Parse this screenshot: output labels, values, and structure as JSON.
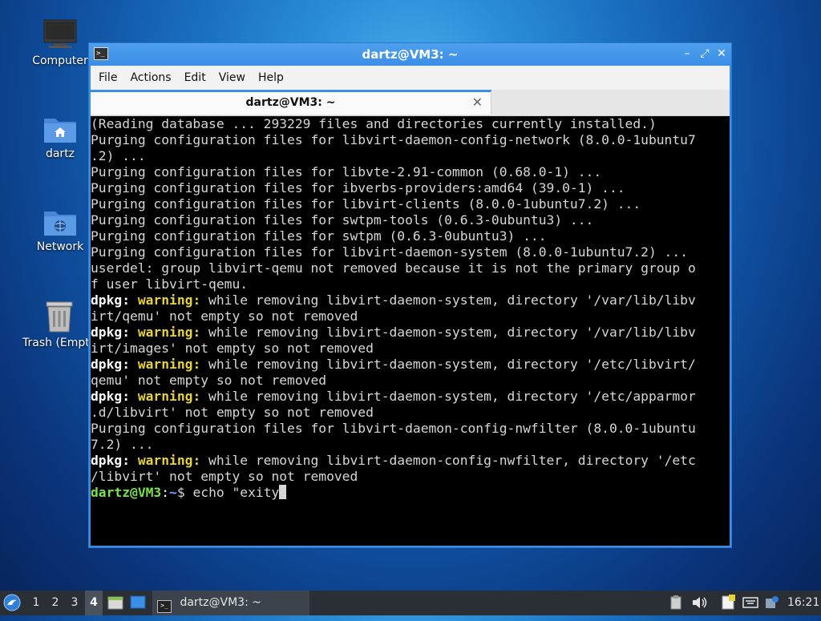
{
  "desktop": {
    "icons": [
      {
        "label": "Computer"
      },
      {
        "label": "dartz"
      },
      {
        "label": "Network"
      },
      {
        "label": "Trash (Empty)"
      }
    ]
  },
  "window": {
    "title": "dartz@VM3: ~",
    "controls": {
      "minimize": "–",
      "maximize": "⤢",
      "close": "✕"
    },
    "menu": [
      "File",
      "Actions",
      "Edit",
      "View",
      "Help"
    ],
    "tab": {
      "label": "dartz@VM3: ~",
      "close": "✕"
    }
  },
  "terminal": {
    "lines": [
      [
        {
          "t": "(Reading database ... 293229 files and directories currently installed.)",
          "c": ""
        }
      ],
      [
        {
          "t": "Purging configuration files for libvirt-daemon-config-network (8.0.0-1ubuntu7",
          "c": ""
        }
      ],
      [
        {
          "t": ".2) ...",
          "c": ""
        }
      ],
      [
        {
          "t": "Purging configuration files for libvte-2.91-common (0.68.0-1) ...",
          "c": ""
        }
      ],
      [
        {
          "t": "Purging configuration files for ibverbs-providers:amd64 (39.0-1) ...",
          "c": ""
        }
      ],
      [
        {
          "t": "Purging configuration files for libvirt-clients (8.0.0-1ubuntu7.2) ...",
          "c": ""
        }
      ],
      [
        {
          "t": "Purging configuration files for swtpm-tools (0.6.3-0ubuntu3) ...",
          "c": ""
        }
      ],
      [
        {
          "t": "Purging configuration files for swtpm (0.6.3-0ubuntu3) ...",
          "c": ""
        }
      ],
      [
        {
          "t": "Purging configuration files for libvirt-daemon-system (8.0.0-1ubuntu7.2) ...",
          "c": ""
        }
      ],
      [
        {
          "t": "userdel: group libvirt-qemu not removed because it is not the primary group o",
          "c": ""
        }
      ],
      [
        {
          "t": "f user libvirt-qemu.",
          "c": ""
        }
      ],
      [
        {
          "t": "dpkg: ",
          "c": "dpkg"
        },
        {
          "t": "warning:",
          "c": "warn"
        },
        {
          "t": " while removing libvirt-daemon-system, directory '/var/lib/libv",
          "c": ""
        }
      ],
      [
        {
          "t": "irt/qemu' not empty so not removed",
          "c": ""
        }
      ],
      [
        {
          "t": "dpkg: ",
          "c": "dpkg"
        },
        {
          "t": "warning:",
          "c": "warn"
        },
        {
          "t": " while removing libvirt-daemon-system, directory '/var/lib/libv",
          "c": ""
        }
      ],
      [
        {
          "t": "irt/images' not empty so not removed",
          "c": ""
        }
      ],
      [
        {
          "t": "dpkg: ",
          "c": "dpkg"
        },
        {
          "t": "warning:",
          "c": "warn"
        },
        {
          "t": " while removing libvirt-daemon-system, directory '/etc/libvirt/",
          "c": ""
        }
      ],
      [
        {
          "t": "qemu' not empty so not removed",
          "c": ""
        }
      ],
      [
        {
          "t": "dpkg: ",
          "c": "dpkg"
        },
        {
          "t": "warning:",
          "c": "warn"
        },
        {
          "t": " while removing libvirt-daemon-system, directory '/etc/apparmor",
          "c": ""
        }
      ],
      [
        {
          "t": ".d/libvirt' not empty so not removed",
          "c": ""
        }
      ],
      [
        {
          "t": "Purging configuration files for libvirt-daemon-config-nwfilter (8.0.0-1ubuntu",
          "c": ""
        }
      ],
      [
        {
          "t": "7.2) ...",
          "c": ""
        }
      ],
      [
        {
          "t": "dpkg: ",
          "c": "dpkg"
        },
        {
          "t": "warning:",
          "c": "warn"
        },
        {
          "t": " while removing libvirt-daemon-config-nwfilter, directory '/etc",
          "c": ""
        }
      ],
      [
        {
          "t": "/libvirt' not empty so not removed",
          "c": ""
        }
      ]
    ],
    "prompt": {
      "user_host": "dartz@VM3",
      "sep": ":",
      "path": "~",
      "dollar": "$ ",
      "command": "echo \"exity"
    }
  },
  "taskbar": {
    "workspaces": [
      "1",
      "2",
      "3",
      "4"
    ],
    "active_workspace": "4",
    "task_label": "dartz@VM3: ~",
    "clock": "16:21"
  }
}
